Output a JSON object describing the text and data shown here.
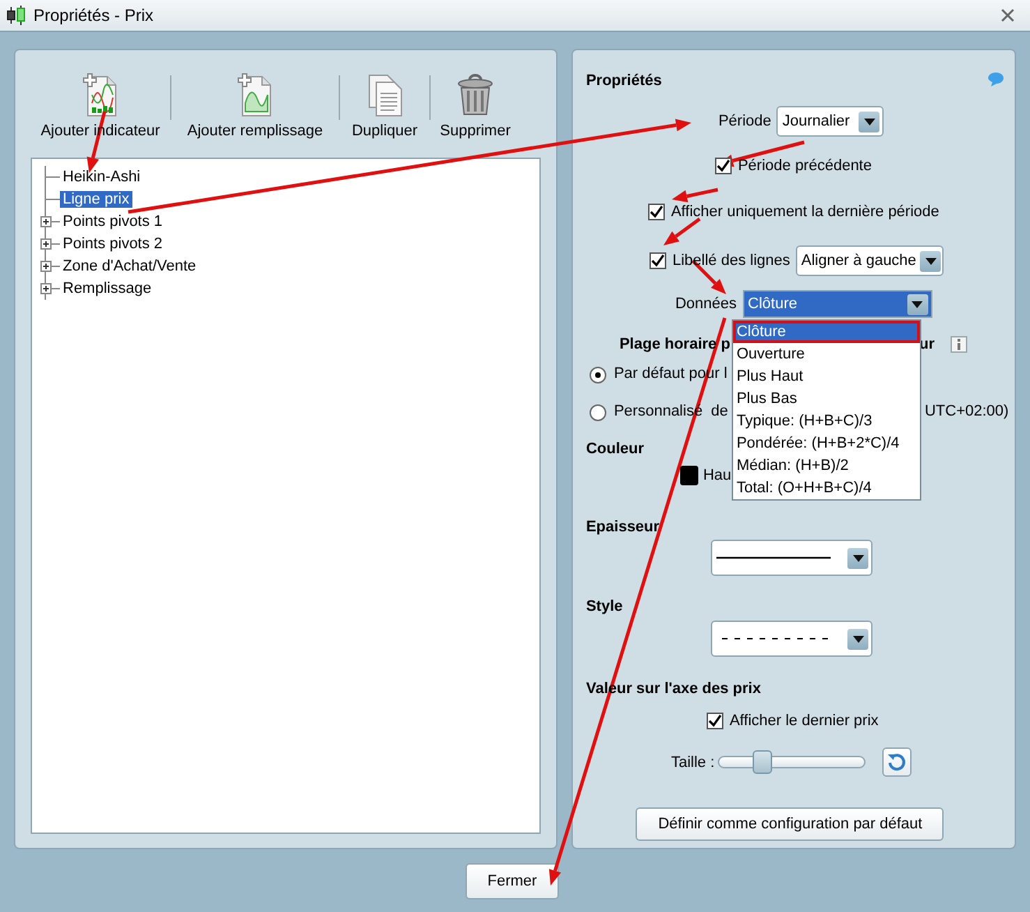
{
  "window": {
    "title": "Propriétés - Prix"
  },
  "toolbar": [
    {
      "label": "Ajouter indicateur",
      "kind": "indicator"
    },
    {
      "label": "Ajouter remplissage",
      "kind": "fill"
    },
    {
      "label": "Dupliquer",
      "kind": "duplicate"
    },
    {
      "label": "Supprimer",
      "kind": "delete"
    }
  ],
  "tree": [
    {
      "label": "Heikin-Ashi",
      "selected": false,
      "expandable": false
    },
    {
      "label": "Ligne prix",
      "selected": true,
      "expandable": false
    },
    {
      "label": "Points pivots 1",
      "selected": false,
      "expandable": true
    },
    {
      "label": "Points pivots 2",
      "selected": false,
      "expandable": true
    },
    {
      "label": "Zone d'Achat/Vente",
      "selected": false,
      "expandable": true
    },
    {
      "label": "Remplissage",
      "selected": false,
      "expandable": true
    }
  ],
  "properties": {
    "title": "Propriétés",
    "period": {
      "label": "Période",
      "value": "Journalier"
    },
    "previous_period": {
      "label": "Période précédente",
      "checked": true
    },
    "last_period_only": {
      "label": "Afficher uniquement la dernière période",
      "checked": true
    },
    "line_labels": {
      "label": "Libellé des lignes",
      "checked": true,
      "value": "Aligner à gauche"
    },
    "data": {
      "label": "Données",
      "value": "Clôture",
      "options": [
        {
          "label": "Clôture",
          "selected": true
        },
        {
          "label": "Ouverture",
          "selected": false
        },
        {
          "label": "Plus Haut",
          "selected": false
        },
        {
          "label": "Plus Bas",
          "selected": false
        },
        {
          "label": "Typique: (H+B+C)/3",
          "selected": false
        },
        {
          "label": "Pondérée: (H+B+2*C)/4",
          "selected": false
        },
        {
          "label": "Médian: (H+B)/2",
          "selected": false
        },
        {
          "label": "Total: (O+H+B+C)/4",
          "selected": false
        }
      ]
    },
    "time_range": {
      "title_start": "Plage horaire p",
      "title_end": "ur",
      "options": [
        {
          "label_start": "Par défaut pour l",
          "selected": true
        },
        {
          "label_start": "Personnalisé  de",
          "label_end": "UTC+02:00)",
          "selected": false
        }
      ]
    },
    "color": {
      "title": "Couleur",
      "color": "#000000",
      "label": "Hau"
    },
    "thickness": {
      "title": "Epaisseur"
    },
    "style": {
      "title": "Style"
    },
    "axis_value": {
      "title": "Valeur sur l'axe des prix",
      "show_last": {
        "label": "Afficher le dernier prix",
        "checked": true
      },
      "size_label": "Taille :",
      "size": {
        "level": 0.3
      }
    },
    "default_button": "Définir comme configuration par défaut"
  },
  "close_button": "Fermer"
}
